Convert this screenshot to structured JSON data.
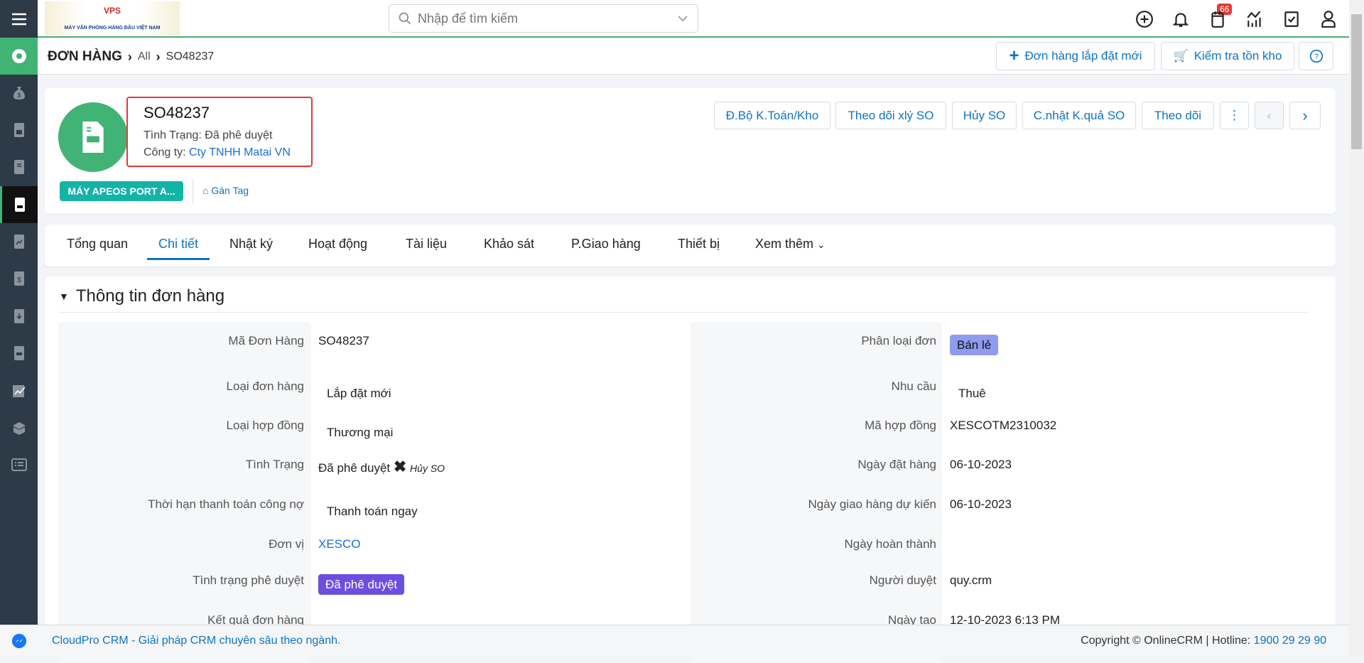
{
  "colors": {
    "sidebar": "#2d3a47",
    "accent_green": "#41b375",
    "link": "#1a6fd6",
    "button_text": "#0b74c4",
    "approved_badge": "#6b4fe0",
    "retail_badge": "#8f9bef",
    "tag_badge": "#14b3a8",
    "notification_badge": "#e53935"
  },
  "sidebar": {
    "items": [
      "menu-icon",
      "dashboard-icon",
      "money-bag-icon",
      "invoice-icon",
      "book-icon",
      "sales-order-icon",
      "document-chart-icon",
      "dollar-document-icon",
      "download-document-icon",
      "printer-document-icon",
      "report-chart-icon",
      "box-icon",
      "list-icon"
    ]
  },
  "topbar": {
    "logo_text": "MÁY VĂN PHÒNG HÀNG ĐẦU VIỆT NAM",
    "logo_brand": "VPS",
    "search_placeholder": "Nhập để tìm kiếm",
    "notification_count": "66"
  },
  "breadcrumb": {
    "module": "ĐƠN HÀNG",
    "view": "All",
    "record": "SO48237"
  },
  "actions": {
    "new_install_order": "Đơn hàng lắp đặt mới",
    "check_stock": "Kiểm tra tồn kho"
  },
  "record": {
    "id": "SO48237",
    "status_label": "Tình Trạng:",
    "status": "Đã phê duyệt",
    "company_label": "Công ty:",
    "company": "Cty TNHH Matai VN",
    "tag": "MÁY APEOS PORT A...",
    "add_tag": "Gán Tag"
  },
  "record_buttons": [
    "Đ.Bộ K.Toán/Kho",
    "Theo dõi xlý SO",
    "Hủy SO",
    "C.nhật K.quả SO",
    "Theo dõi"
  ],
  "tabs": [
    {
      "label": "Tổng quan"
    },
    {
      "label": "Chi tiết",
      "active": true
    },
    {
      "label": "Nhật ký"
    },
    {
      "label": "Hoạt động"
    },
    {
      "label": "Tài liệu"
    },
    {
      "label": "Khảo sát"
    },
    {
      "label": "P.Giao hàng"
    },
    {
      "label": "Thiết bị"
    },
    {
      "label": "Xem thêm"
    }
  ],
  "section": {
    "title": "Thông tin đơn hàng",
    "left": [
      {
        "label": "Mã Đơn Hàng",
        "value": "SO48237"
      },
      {
        "label": "Loại đơn hàng",
        "value": "Lắp đặt mới"
      },
      {
        "label": "Loại hợp đồng",
        "value": "Thương mại"
      },
      {
        "label": "Tình Trạng",
        "value": "Đã phê duyệt",
        "extra": "Hủy SO"
      },
      {
        "label": "Thời hạn thanh toán công nợ",
        "value": "Thanh toán ngay"
      },
      {
        "label": "Đơn vị",
        "value": "XESCO"
      },
      {
        "label": "Tình trạng phê duyệt",
        "value": "Đã phê duyệt"
      },
      {
        "label": "Kết quả đơn hàng",
        "value": ""
      }
    ],
    "right": [
      {
        "label": "Phân loại đơn",
        "value": "Bán lẻ"
      },
      {
        "label": "Nhu cầu",
        "value": "Thuê"
      },
      {
        "label": "Mã hợp đồng",
        "value": "XESCOTM2310032"
      },
      {
        "label": "Ngày đặt hàng",
        "value": "06-10-2023"
      },
      {
        "label": "Ngày giao hàng dự kiến",
        "value": "06-10-2023"
      },
      {
        "label": "Ngày hoàn thành",
        "value": ""
      },
      {
        "label": "Người duyệt",
        "value": "quy.crm"
      },
      {
        "label": "Ngày tạo",
        "value": "12-10-2023 6:13 PM"
      }
    ]
  },
  "footer": {
    "tagline": "CloudPro CRM - Giải pháp CRM chuyên sâu theo ngành.",
    "copyright": "Copyright © OnlineCRM",
    "hotline_label": "Hotline:",
    "hotline": "1900 29 29 90"
  }
}
